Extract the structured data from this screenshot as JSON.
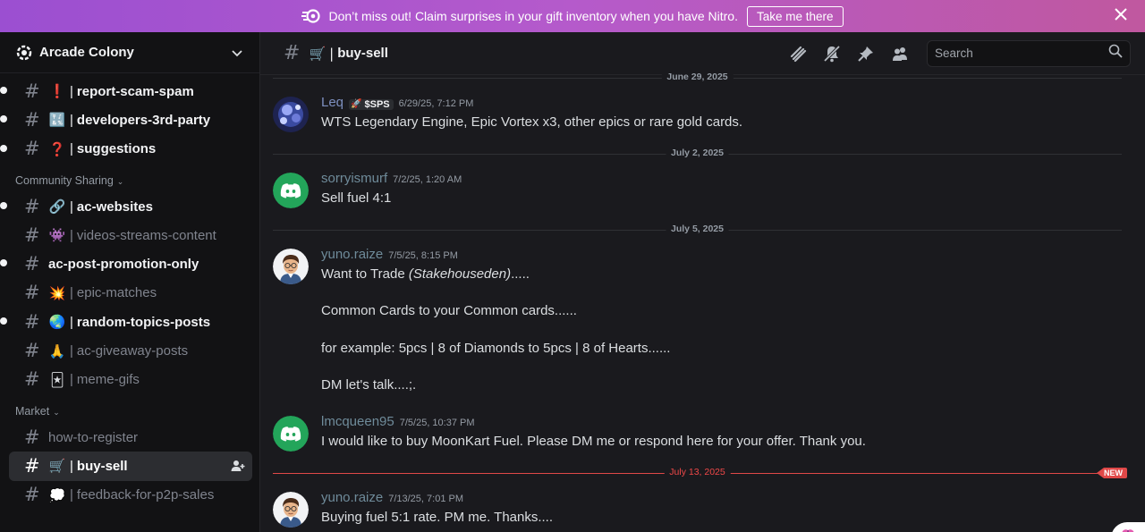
{
  "banner": {
    "text": "Don’t miss out! Claim surprises in your gift inventory when you have Nitro.",
    "cta": "Take me there"
  },
  "server": {
    "name": "Arcade Colony"
  },
  "channels": [
    {
      "emoji": "❗",
      "name": "report-scam-spam",
      "sep": "|"
    },
    {
      "emoji": "🔣",
      "name": "developers-3rd-party",
      "sep": "|"
    },
    {
      "emoji": "❓",
      "name": "suggestions",
      "sep": "|"
    },
    {
      "category": "Community Sharing"
    },
    {
      "emoji": "🔗",
      "name": "ac-websites",
      "sep": "|"
    },
    {
      "emoji": "👾",
      "name": "videos-streams-content",
      "sep": "|"
    },
    {
      "emoji": "",
      "name": "ac-post-promotion-only",
      "sep": ""
    },
    {
      "emoji": "💥",
      "name": "epic-matches",
      "sep": "|"
    },
    {
      "emoji": "🌏",
      "name": "random-topics-posts",
      "sep": "|"
    },
    {
      "emoji": "🙏",
      "name": "ac-giveaway-posts",
      "sep": "|"
    },
    {
      "emoji": "🃏",
      "name": "meme-gifs",
      "sep": "|"
    },
    {
      "category": "Market"
    },
    {
      "emoji": "",
      "name": "how-to-register",
      "sep": ""
    },
    {
      "emoji": "🛒",
      "name": "buy-sell",
      "sep": "|"
    },
    {
      "emoji": "💭",
      "name": "feedback-for-p2p-sales",
      "sep": "|"
    }
  ],
  "topbar": {
    "emoji": "🛒",
    "sep": "|",
    "name": "buy-sell",
    "search_placeholder": "Search"
  },
  "dates": {
    "d1": "June 29, 2025",
    "d2": "July 2, 2025",
    "d3": "July 5, 2025",
    "d4": "July 13, 2025",
    "new_badge": "NEW"
  },
  "messages": {
    "m1": {
      "author": "Leq",
      "tag": "$SPS",
      "time": "6/29/25, 7:12 PM",
      "body": "WTS Legendary Engine, Epic Vortex x3, other epics or rare gold cards."
    },
    "m2": {
      "author": "sorryismurf",
      "time": "7/2/25, 1:20 AM",
      "body": "Sell fuel 4:1"
    },
    "m3": {
      "author": "yuno.raize",
      "time": "7/5/25, 8:15 PM",
      "line1_a": "Want to Trade ",
      "line1_b": "(Stakehouseden)",
      "line1_c": ".....",
      "line2": "Common Cards to your Common cards......",
      "line3": "for example: 5pcs | 8 of Diamonds to 5pcs | 8 of Hearts......",
      "line4": "DM let's talk....;."
    },
    "m4": {
      "author": "lmcqueen95",
      "time": "7/5/25, 10:37 PM",
      "body": "I would like to buy MoonKart Fuel. Please DM me or respond here for your offer. Thank you."
    },
    "m5": {
      "author": "yuno.raize",
      "time": "7/13/25, 7:01 PM",
      "body": "Buying fuel 5:1 rate. PM me. Thanks...."
    }
  },
  "colors": {
    "accent": "#5865f2",
    "discord_green": "#23a55a",
    "new_red": "#e04848"
  }
}
